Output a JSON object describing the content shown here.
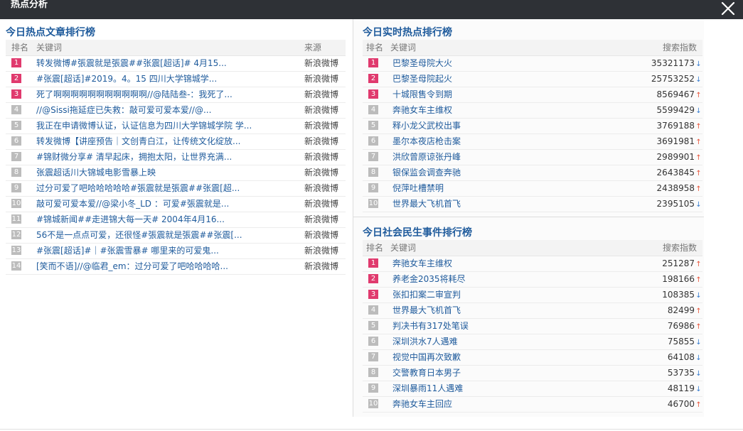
{
  "window": {
    "title": "热点分析"
  },
  "colors": {
    "hot_rank": "#e03a6e",
    "normal_rank": "#bcbcbc",
    "title_blue": "#1f5b9c",
    "up": "#e8543a",
    "down": "#3a7fd1"
  },
  "icons": {
    "close": "close-icon",
    "up": "arrow-up-icon",
    "down": "arrow-down-icon"
  },
  "articles": {
    "title": "今日热点文章排行榜",
    "headers": {
      "rank": "排名",
      "keyword": "关键词",
      "source": "来源"
    },
    "rows": [
      {
        "rank": "1",
        "keyword": "转发微博#張震就是張震##张震[超话]# 4月15...",
        "source": "新浪微博"
      },
      {
        "rank": "2",
        "keyword": "#张震[超话]#2019。4。15 四川大学锦城学...",
        "source": "新浪微博"
      },
      {
        "rank": "3",
        "keyword": "死了啊啊啊啊啊啊啊啊啊啊啊//@陆陆叁-：我死了...",
        "source": "新浪微博"
      },
      {
        "rank": "4",
        "keyword": "//@Sissi拖延症已失救：敲可爱可爱本爱//@...",
        "source": "新浪微博"
      },
      {
        "rank": "5",
        "keyword": "我正在申请微博认证，认证信息为四川大学锦城学院 学...",
        "source": "新浪微博"
      },
      {
        "rank": "6",
        "keyword": "转发微博【讲座预告｜文创青白江，让传统文化绽放...",
        "source": "新浪微博"
      },
      {
        "rank": "7",
        "keyword": "#锦财微分享# 清早起床，拥抱太阳，让世界充满...",
        "source": "新浪微博"
      },
      {
        "rank": "8",
        "keyword": "张震超话川大锦城电影雪暴上映",
        "source": "新浪微博"
      },
      {
        "rank": "9",
        "keyword": "过分可爱了吧哈哈哈哈哈#張震就是張震##张震[超...",
        "source": "新浪微博"
      },
      {
        "rank": "10",
        "keyword": "敲可爱可爱本爱//@梁小冬_LD ：可爱#張震就是...",
        "source": "新浪微博"
      },
      {
        "rank": "11",
        "keyword": "#锦城新闻##走进锦大每一天# 2004年4月16...",
        "source": "新浪微博"
      },
      {
        "rank": "12",
        "keyword": "56不是一点点可爱，还很怪#張震就是張震##张震[...",
        "source": "新浪微博"
      },
      {
        "rank": "13",
        "keyword": "#张震[超话]#｜#张震雪暴# 哪里来的可爱鬼...",
        "source": "新浪微博"
      },
      {
        "rank": "14",
        "keyword": "[笑而不语]//@临君_em：过分可爱了吧哈哈哈哈...",
        "source": "新浪微博"
      }
    ]
  },
  "realtime": {
    "title": "今日实时热点排行榜",
    "headers": {
      "rank": "排名",
      "keyword": "关键词",
      "index": "搜索指数"
    },
    "rows": [
      {
        "rank": "1",
        "keyword": "巴黎圣母院大火",
        "index": "35321173",
        "trend": "down"
      },
      {
        "rank": "2",
        "keyword": "巴黎圣母院起火",
        "index": "25753252",
        "trend": "down"
      },
      {
        "rank": "3",
        "keyword": "十城限售令到期",
        "index": "8569467",
        "trend": "up"
      },
      {
        "rank": "4",
        "keyword": "奔驰女车主维权",
        "index": "5599429",
        "trend": "down"
      },
      {
        "rank": "5",
        "keyword": "释小龙父武校出事",
        "index": "3769188",
        "trend": "up"
      },
      {
        "rank": "6",
        "keyword": "墨尔本夜店枪击案",
        "index": "3691981",
        "trend": "up"
      },
      {
        "rank": "7",
        "keyword": "洪欣曾原谅张丹峰",
        "index": "2989901",
        "trend": "up"
      },
      {
        "rank": "8",
        "keyword": "银保监会调查奔驰",
        "index": "2643845",
        "trend": "up"
      },
      {
        "rank": "9",
        "keyword": "倪萍吐槽禁明",
        "index": "2438958",
        "trend": "up"
      },
      {
        "rank": "10",
        "keyword": "世界最大飞机首飞",
        "index": "2395105",
        "trend": "down"
      }
    ]
  },
  "social": {
    "title": "今日社会民生事件排行榜",
    "headers": {
      "rank": "排名",
      "keyword": "关键词",
      "index": "搜索指数"
    },
    "rows": [
      {
        "rank": "1",
        "keyword": "奔驰女车主维权",
        "index": "251287",
        "trend": "up"
      },
      {
        "rank": "2",
        "keyword": "养老金2035将耗尽",
        "index": "198166",
        "trend": "up"
      },
      {
        "rank": "3",
        "keyword": "张扣扣案二审宣判",
        "index": "108385",
        "trend": "down"
      },
      {
        "rank": "4",
        "keyword": "世界最大飞机首飞",
        "index": "82499",
        "trend": "up"
      },
      {
        "rank": "5",
        "keyword": "判决书有317处笔误",
        "index": "76986",
        "trend": "up"
      },
      {
        "rank": "6",
        "keyword": "深圳洪水7人遇难",
        "index": "75855",
        "trend": "down"
      },
      {
        "rank": "7",
        "keyword": "视觉中国再次致歉",
        "index": "64108",
        "trend": "down"
      },
      {
        "rank": "8",
        "keyword": "交警教育日本男子",
        "index": "53735",
        "trend": "down"
      },
      {
        "rank": "9",
        "keyword": "深圳暴雨11人遇难",
        "index": "48119",
        "trend": "down"
      },
      {
        "rank": "10",
        "keyword": "奔驰女车主回应",
        "index": "46700",
        "trend": "up"
      }
    ]
  }
}
